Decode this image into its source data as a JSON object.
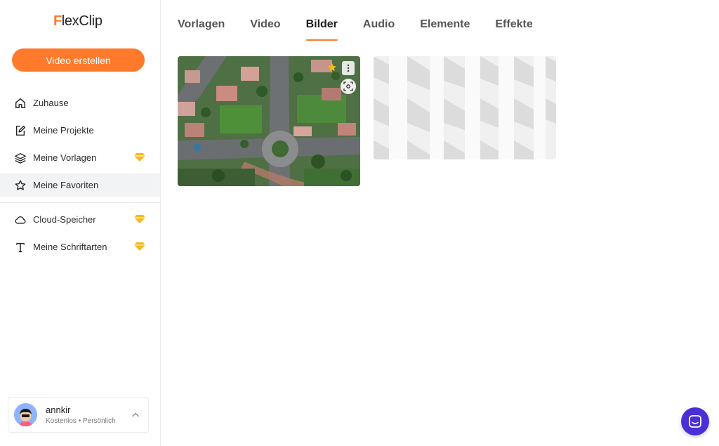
{
  "app": {
    "logo_first": "F",
    "logo_rest": "lexClip",
    "brand_color": "#ff7a2b"
  },
  "sidebar": {
    "create_label": "Video erstellen",
    "items": [
      {
        "label": "Zuhause",
        "icon": "home-icon",
        "premium": false
      },
      {
        "label": "Meine Projekte",
        "icon": "edit-icon",
        "premium": false
      },
      {
        "label": "Meine Vorlagen",
        "icon": "layers-icon",
        "premium": true
      },
      {
        "label": "Meine Favoriten",
        "icon": "star-outline-icon",
        "premium": false,
        "active": true
      },
      {
        "label": "Cloud-Speicher",
        "icon": "cloud-icon",
        "premium": true
      },
      {
        "label": "Meine Schriftarten",
        "icon": "text-icon",
        "premium": true
      }
    ],
    "premium_color": "#f9b81d"
  },
  "user": {
    "name": "annkir",
    "plan": "Kostenlos • Persönlich"
  },
  "tabs": [
    {
      "label": "Vorlagen",
      "active": false
    },
    {
      "label": "Video",
      "active": false
    },
    {
      "label": "Bilder",
      "active": true
    },
    {
      "label": "Audio",
      "active": false
    },
    {
      "label": "Elemente",
      "active": false
    },
    {
      "label": "Effekte",
      "active": false
    }
  ],
  "images": [
    {
      "name": "aerial-neighborhood-roundabout",
      "favorite": true
    },
    {
      "name": "white-geometric-wall",
      "favorite": false
    }
  ],
  "chat": {
    "icon": "chat-icon",
    "color": "#4b2fd6"
  }
}
